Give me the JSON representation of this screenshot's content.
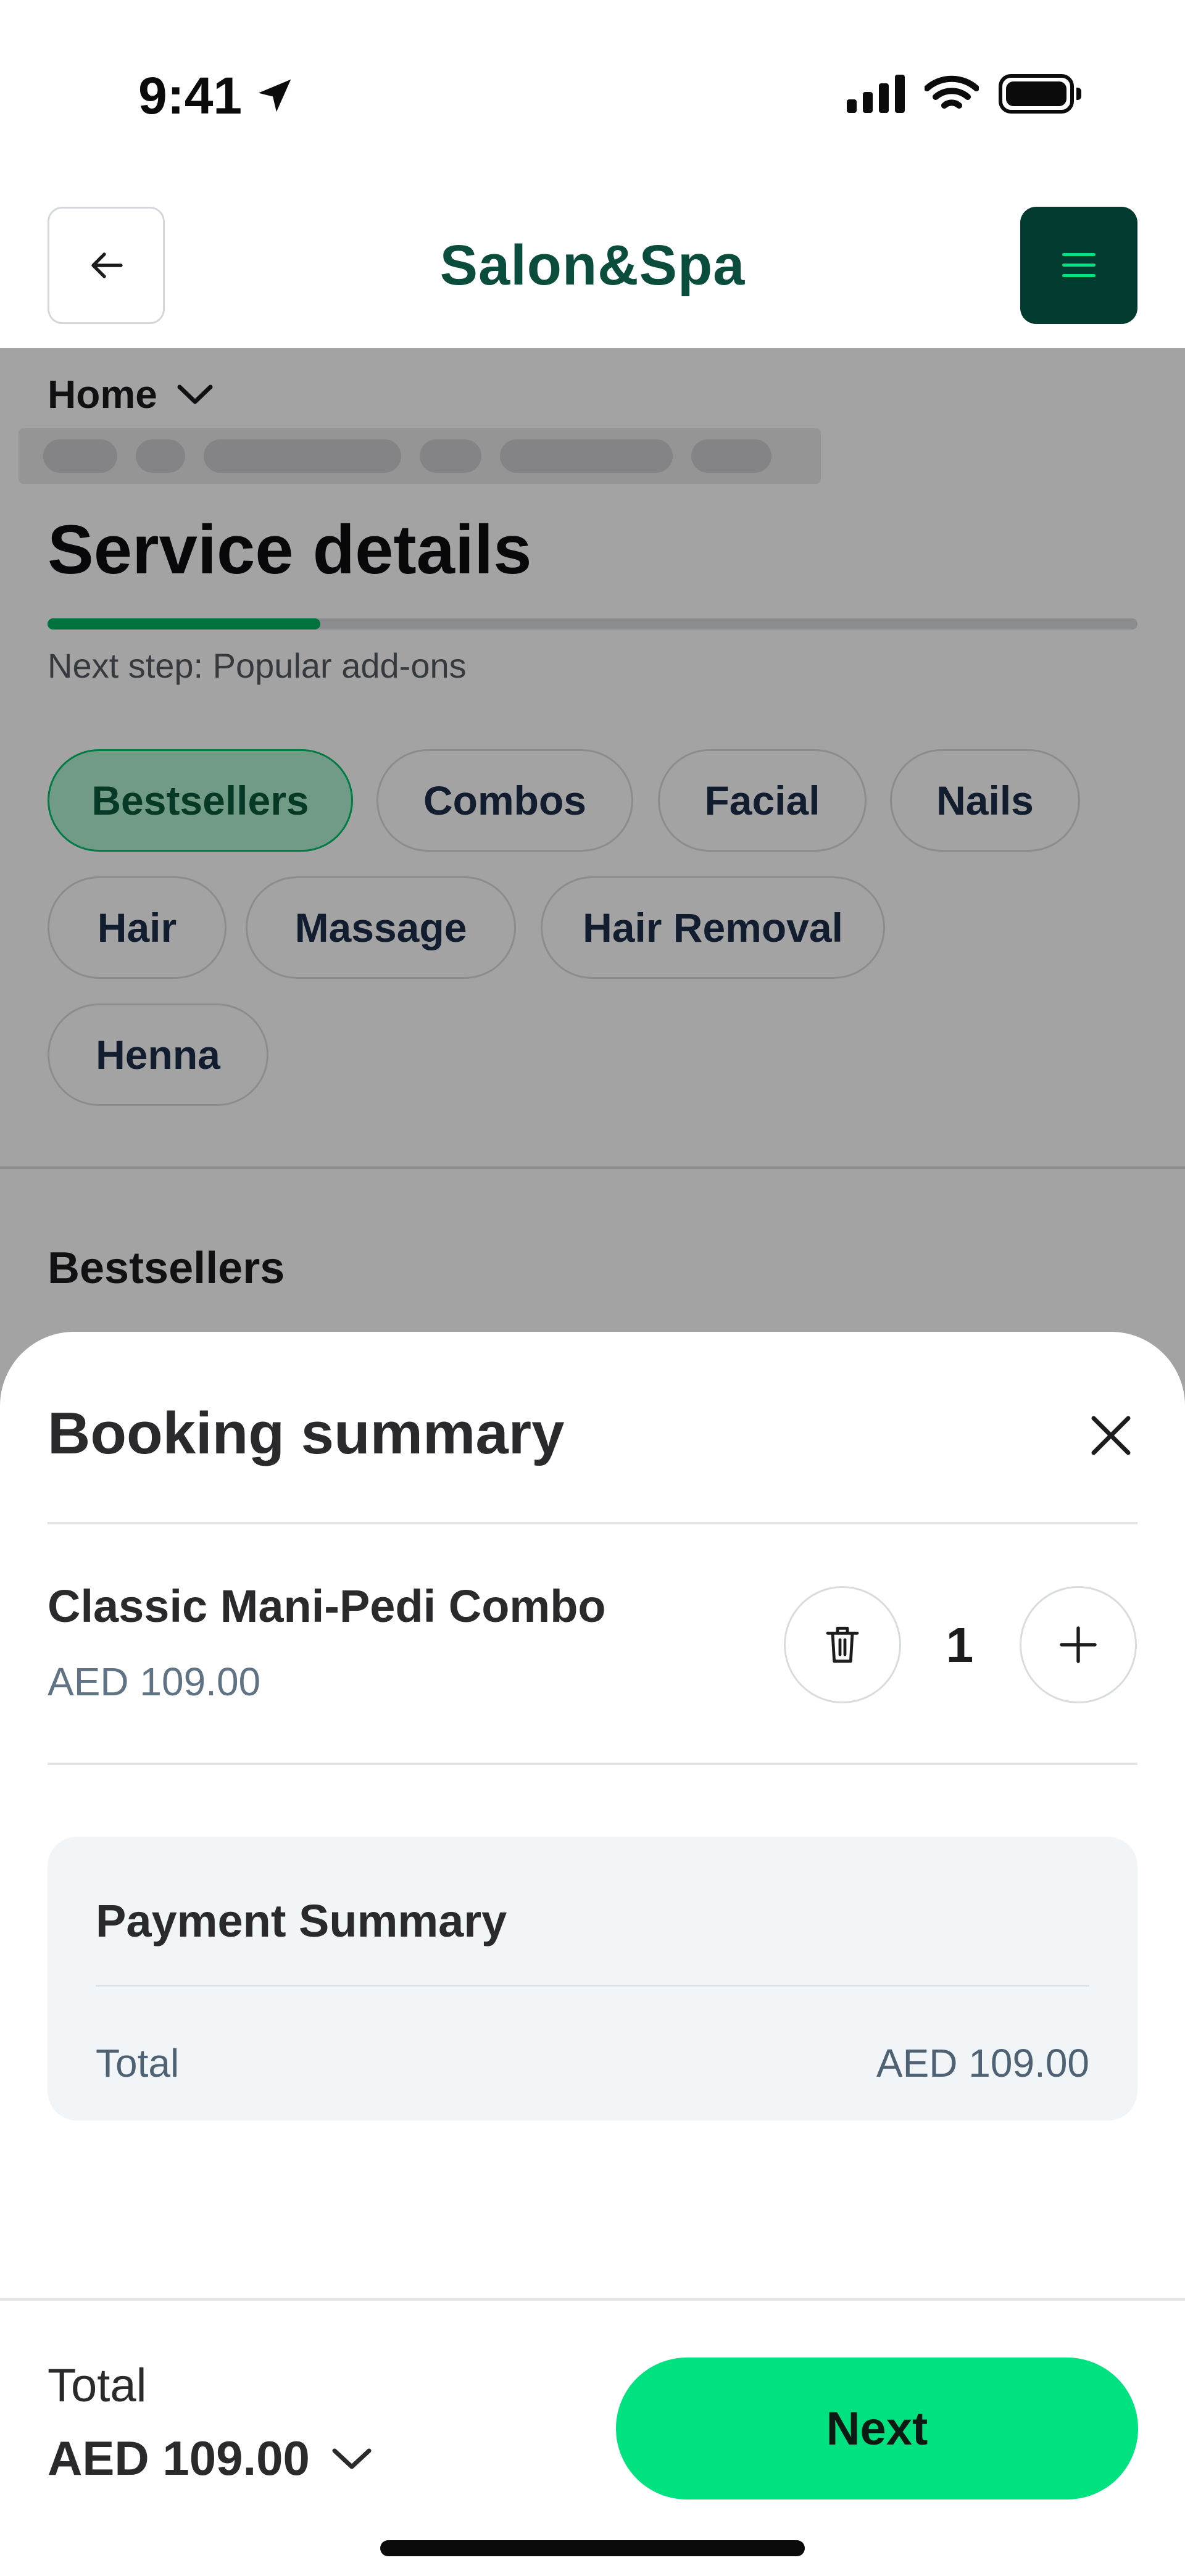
{
  "status_bar": {
    "time": "9:41"
  },
  "header": {
    "brand": "Salon&Spa"
  },
  "page": {
    "breadcrumb": "Home",
    "title": "Service details",
    "progress": 0.25,
    "next_step": "Next step: Popular add-ons",
    "categories": [
      "Bestsellers",
      "Combos",
      "Facial",
      "Nails",
      "Hair",
      "Massage",
      "Hair Removal",
      "Henna"
    ],
    "active_category": "Bestsellers",
    "section_title": "Bestsellers"
  },
  "sheet": {
    "title": "Booking summary",
    "item": {
      "name": "Classic Mani-Pedi Combo",
      "price": "AED 109.00",
      "quantity": "1"
    },
    "payment_summary": {
      "title": "Payment Summary",
      "total_label": "Total",
      "total_value": "AED 109.00"
    },
    "footer": {
      "total_label": "Total",
      "total_value": "AED 109.00",
      "next_label": "Next"
    }
  },
  "colors": {
    "brand": "#0b4d3d",
    "accent": "#00e280",
    "menu_bg": "#013a2f",
    "progress": "#00b260"
  },
  "icons": [
    "location-arrow-icon",
    "signal-icon",
    "wifi-icon",
    "battery-icon",
    "arrow-left-icon",
    "hamburger-menu-icon",
    "chevron-down-icon",
    "close-icon",
    "trash-icon",
    "plus-icon"
  ]
}
